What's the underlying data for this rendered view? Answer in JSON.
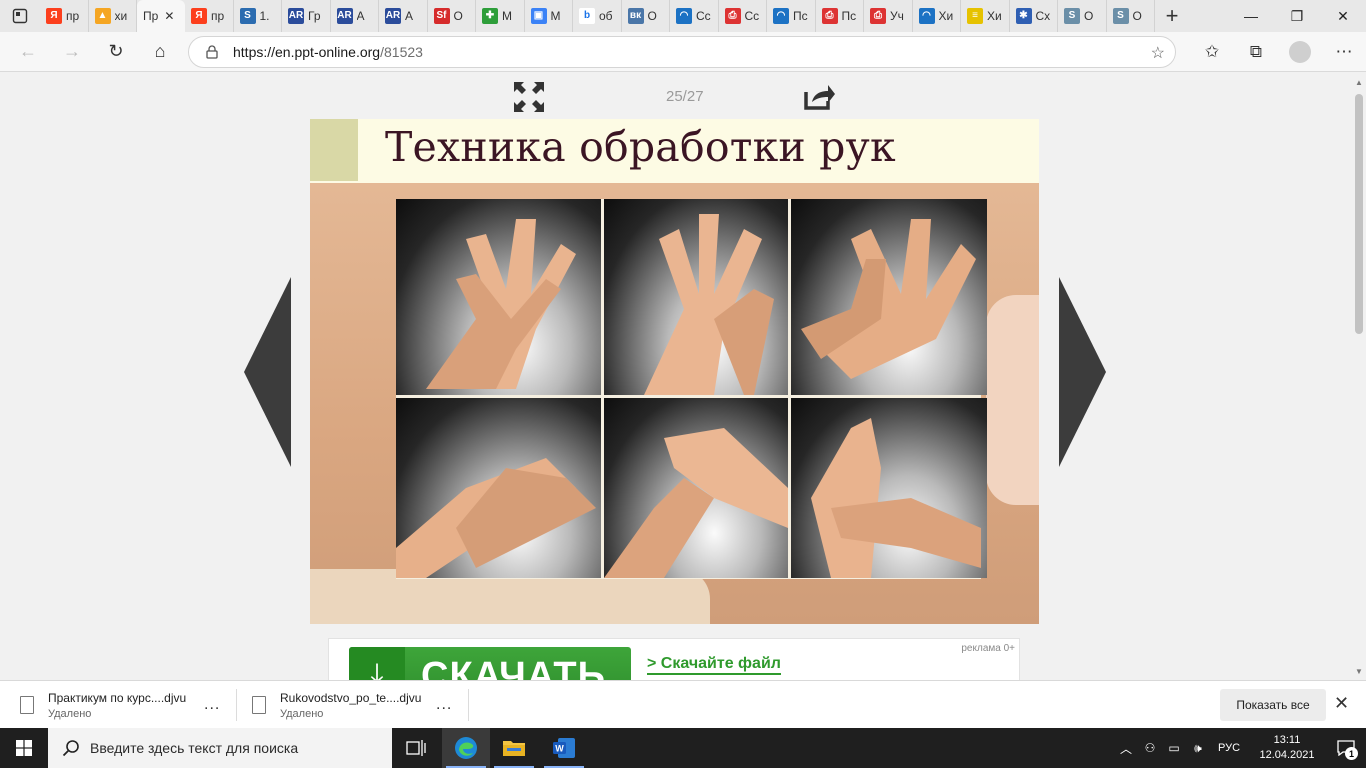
{
  "browser": {
    "tabs": [
      {
        "icon": "yandex-icon",
        "label": "пр",
        "color": "#fc3f1d",
        "glyph": "Я"
      },
      {
        "icon": "image-search-icon",
        "label": "хи",
        "color": "#f5a623",
        "glyph": "▲"
      },
      {
        "icon": "page-icon",
        "label": "Пр",
        "color": "#cccccc",
        "glyph": "",
        "active": true
      },
      {
        "icon": "yandex-icon",
        "label": "пр",
        "color": "#fc3f1d",
        "glyph": "Я"
      },
      {
        "icon": "s-site-icon",
        "label": "1.",
        "color": "#2b6cb0",
        "glyph": "S"
      },
      {
        "icon": "ar-site-icon",
        "label": "Гр",
        "color": "#2b4c9b",
        "glyph": "AR"
      },
      {
        "icon": "ar-site-icon",
        "label": "А",
        "color": "#2b4c9b",
        "glyph": "AR"
      },
      {
        "icon": "ar-site-icon",
        "label": "А",
        "color": "#2b4c9b",
        "glyph": "AR"
      },
      {
        "icon": "studfiles-icon",
        "label": "О",
        "color": "#d62b2b",
        "glyph": "Sf"
      },
      {
        "icon": "medical-plus-icon",
        "label": "М",
        "color": "#2e9e3a",
        "glyph": "✚"
      },
      {
        "icon": "chat-icon",
        "label": "М",
        "color": "#3b82f6",
        "glyph": "▣"
      },
      {
        "icon": "bing-icon",
        "label": "об",
        "color": "#ffffff",
        "glyph": "b"
      },
      {
        "icon": "vk-icon",
        "label": "О",
        "color": "#4a76a8",
        "glyph": "вк"
      },
      {
        "icon": "edge-page-icon",
        "label": "Сс",
        "color": "#1c72c4",
        "glyph": "◠"
      },
      {
        "icon": "pdf-icon",
        "label": "Сс",
        "color": "#d33",
        "glyph": "⎙"
      },
      {
        "icon": "edge-page-icon",
        "label": "Пс",
        "color": "#1c72c4",
        "glyph": "◠"
      },
      {
        "icon": "pdf-icon",
        "label": "Пс",
        "color": "#d33",
        "glyph": "⎙"
      },
      {
        "icon": "pdf-icon",
        "label": "Уч",
        "color": "#d33",
        "glyph": "⎙"
      },
      {
        "icon": "edge-page-icon",
        "label": "Хи",
        "color": "#1c72c4",
        "glyph": "◠"
      },
      {
        "icon": "document-icon",
        "label": "Хи",
        "color": "#e6c200",
        "glyph": "≡"
      },
      {
        "icon": "medical-star-icon",
        "label": "Сх",
        "color": "#2f5fb3",
        "glyph": "✱"
      },
      {
        "icon": "s-site-icon",
        "label": "О",
        "color": "#6b8fa8",
        "glyph": "S"
      },
      {
        "icon": "s-site-icon",
        "label": "О",
        "color": "#6b8fa8",
        "glyph": "S"
      }
    ],
    "url_host": "https://en.ppt-online.org",
    "url_path": "/81523"
  },
  "viewer": {
    "counter": "25/27",
    "slide_title": "Техника обработки рук"
  },
  "ad": {
    "label": "реклама 0+",
    "button_text": "СКАЧАТЬ",
    "link_text": "> Скачайте файл"
  },
  "downloads": {
    "items": [
      {
        "name": "Практикум по курс....djvu",
        "status": "Удалено"
      },
      {
        "name": "Rukovodstvo_po_te....djvu",
        "status": "Удалено"
      }
    ],
    "more_label": "...",
    "show_all": "Показать все"
  },
  "taskbar": {
    "search_placeholder": "Введите здесь текст для поиска",
    "lang": "РУС",
    "time": "13:11",
    "date": "12.04.2021",
    "notifications": "1"
  }
}
